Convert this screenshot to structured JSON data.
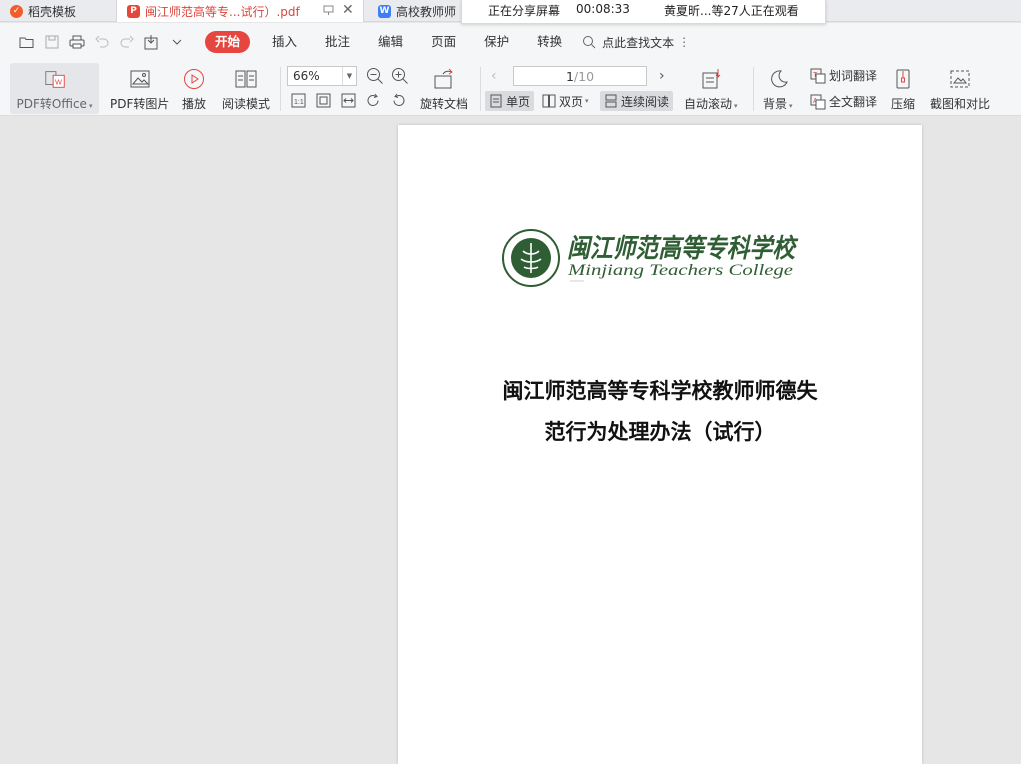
{
  "tabs": [
    {
      "label": "稻壳模板",
      "icon": "docer-icon"
    },
    {
      "label": "闽江师范高等专...试行）.pdf",
      "icon": "pdf-file-icon"
    },
    {
      "label": "高校教师师",
      "icon": "word-file-icon"
    }
  ],
  "share_panel": {
    "status": "正在分享屏幕",
    "timer": "00:08:33",
    "viewers": "黄夏昕...等27人正在观看"
  },
  "menu": {
    "items": [
      "开始",
      "插入",
      "批注",
      "编辑",
      "页面",
      "保护",
      "转换"
    ],
    "active": "开始",
    "search_label": "点此查找文本"
  },
  "ribbon": {
    "pdf_to_office": "PDF转Office",
    "pdf_to_image": "PDF转图片",
    "play": "播放",
    "read_mode": "阅读模式",
    "zoom": "66%",
    "rotate_doc": "旋转文档",
    "page_current": "1",
    "page_total": "/10",
    "single_page": "单页",
    "double_page": "双页",
    "continuous_read": "连续阅读",
    "auto_scroll": "自动滚动",
    "background": "背景",
    "word_translate": "划词翻译",
    "full_translate": "全文翻译",
    "compress": "压缩",
    "screenshot_compare": "截图和对比"
  },
  "document": {
    "logo_cn": "闽江师范高等专科学校",
    "logo_en": "Minjiang Teachers College",
    "title_line1": "闽江师范高等专科学校教师师德失",
    "title_line2": "范行为处理办法（试行）"
  },
  "colors": {
    "accent": "#e5463f",
    "logo_green": "#2f5d34",
    "page_bg": "#ffffff",
    "canvas_bg": "#e6e6e6"
  }
}
